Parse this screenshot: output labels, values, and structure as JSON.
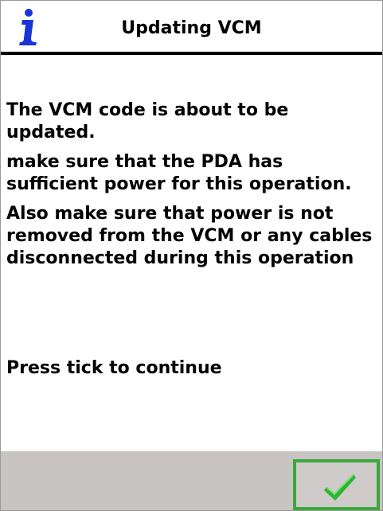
{
  "header": {
    "title": "Updating VCM",
    "icon": "info-icon"
  },
  "body": {
    "paragraphs": [
      "The VCM code is about to be updated.",
      "make sure that the PDA has sufficient power for this operation.",
      "Also make sure that power is not removed from the VCM or any cables disconnected during this operation"
    ],
    "instruction": "Press tick to continue"
  },
  "footer": {
    "button_icon": "tick-icon"
  },
  "colors": {
    "info_icon": "#1a35d6",
    "divider": "#000000",
    "footer_background": "#c8c4c4",
    "button_border": "#3aa83a",
    "tick": "#31b531"
  }
}
